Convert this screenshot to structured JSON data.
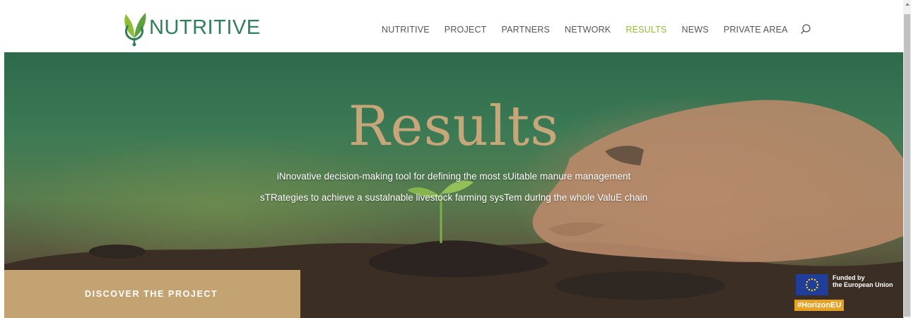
{
  "header": {
    "logo_text": "NUTRITIVE",
    "nav": [
      {
        "label": "NUTRITIVE"
      },
      {
        "label": "PROJECT"
      },
      {
        "label": "PARTNERS"
      },
      {
        "label": "NETWORK"
      },
      {
        "label": "RESULTS",
        "active": true
      },
      {
        "label": "NEWS"
      },
      {
        "label": "PRIVATE AREA"
      }
    ],
    "search_icon": "search-icon"
  },
  "hero": {
    "title": "Results",
    "subtitle_line1": "iNnovative decision-making tool for defining the most sUitable manure management",
    "subtitle_line2": "sTRategies to achieve a sustalnable livestock farming sysTem durlng the whole ValuE chain",
    "cta_label": "DISCOVER THE PROJECT"
  },
  "eu_badge": {
    "funded_line1": "Funded by",
    "funded_line2": "the European Union",
    "hashtag": "#HorizonEU"
  },
  "colors": {
    "brand_green": "#2f7f5a",
    "nav_active": "#8fbf3a",
    "gold": "#c4a373",
    "title_gold": "#c7a77a"
  }
}
